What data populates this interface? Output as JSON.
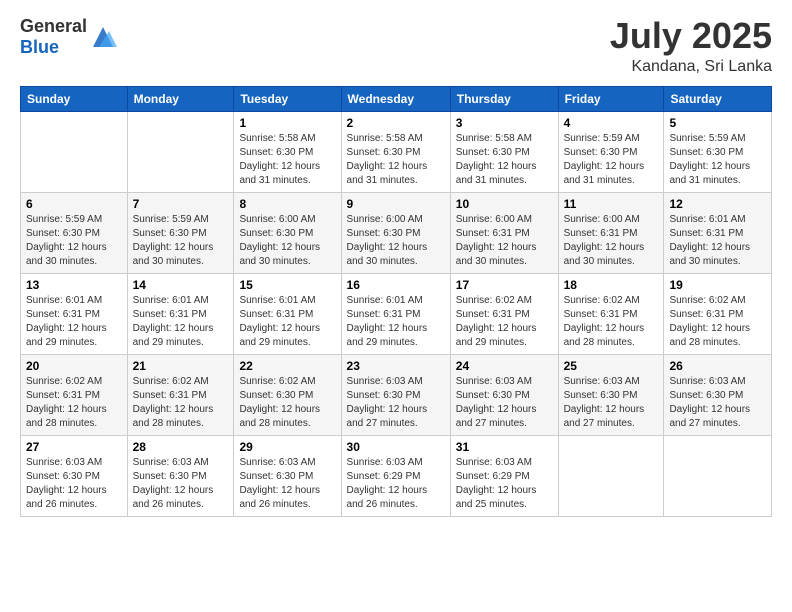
{
  "logo": {
    "text_general": "General",
    "text_blue": "Blue"
  },
  "header": {
    "month_year": "July 2025",
    "location": "Kandana, Sri Lanka"
  },
  "weekdays": [
    "Sunday",
    "Monday",
    "Tuesday",
    "Wednesday",
    "Thursday",
    "Friday",
    "Saturday"
  ],
  "weeks": [
    [
      {
        "day": "",
        "sunrise": "",
        "sunset": "",
        "daylight": ""
      },
      {
        "day": "",
        "sunrise": "",
        "sunset": "",
        "daylight": ""
      },
      {
        "day": "1",
        "sunrise": "Sunrise: 5:58 AM",
        "sunset": "Sunset: 6:30 PM",
        "daylight": "Daylight: 12 hours and 31 minutes."
      },
      {
        "day": "2",
        "sunrise": "Sunrise: 5:58 AM",
        "sunset": "Sunset: 6:30 PM",
        "daylight": "Daylight: 12 hours and 31 minutes."
      },
      {
        "day": "3",
        "sunrise": "Sunrise: 5:58 AM",
        "sunset": "Sunset: 6:30 PM",
        "daylight": "Daylight: 12 hours and 31 minutes."
      },
      {
        "day": "4",
        "sunrise": "Sunrise: 5:59 AM",
        "sunset": "Sunset: 6:30 PM",
        "daylight": "Daylight: 12 hours and 31 minutes."
      },
      {
        "day": "5",
        "sunrise": "Sunrise: 5:59 AM",
        "sunset": "Sunset: 6:30 PM",
        "daylight": "Daylight: 12 hours and 31 minutes."
      }
    ],
    [
      {
        "day": "6",
        "sunrise": "Sunrise: 5:59 AM",
        "sunset": "Sunset: 6:30 PM",
        "daylight": "Daylight: 12 hours and 30 minutes."
      },
      {
        "day": "7",
        "sunrise": "Sunrise: 5:59 AM",
        "sunset": "Sunset: 6:30 PM",
        "daylight": "Daylight: 12 hours and 30 minutes."
      },
      {
        "day": "8",
        "sunrise": "Sunrise: 6:00 AM",
        "sunset": "Sunset: 6:30 PM",
        "daylight": "Daylight: 12 hours and 30 minutes."
      },
      {
        "day": "9",
        "sunrise": "Sunrise: 6:00 AM",
        "sunset": "Sunset: 6:30 PM",
        "daylight": "Daylight: 12 hours and 30 minutes."
      },
      {
        "day": "10",
        "sunrise": "Sunrise: 6:00 AM",
        "sunset": "Sunset: 6:31 PM",
        "daylight": "Daylight: 12 hours and 30 minutes."
      },
      {
        "day": "11",
        "sunrise": "Sunrise: 6:00 AM",
        "sunset": "Sunset: 6:31 PM",
        "daylight": "Daylight: 12 hours and 30 minutes."
      },
      {
        "day": "12",
        "sunrise": "Sunrise: 6:01 AM",
        "sunset": "Sunset: 6:31 PM",
        "daylight": "Daylight: 12 hours and 30 minutes."
      }
    ],
    [
      {
        "day": "13",
        "sunrise": "Sunrise: 6:01 AM",
        "sunset": "Sunset: 6:31 PM",
        "daylight": "Daylight: 12 hours and 29 minutes."
      },
      {
        "day": "14",
        "sunrise": "Sunrise: 6:01 AM",
        "sunset": "Sunset: 6:31 PM",
        "daylight": "Daylight: 12 hours and 29 minutes."
      },
      {
        "day": "15",
        "sunrise": "Sunrise: 6:01 AM",
        "sunset": "Sunset: 6:31 PM",
        "daylight": "Daylight: 12 hours and 29 minutes."
      },
      {
        "day": "16",
        "sunrise": "Sunrise: 6:01 AM",
        "sunset": "Sunset: 6:31 PM",
        "daylight": "Daylight: 12 hours and 29 minutes."
      },
      {
        "day": "17",
        "sunrise": "Sunrise: 6:02 AM",
        "sunset": "Sunset: 6:31 PM",
        "daylight": "Daylight: 12 hours and 29 minutes."
      },
      {
        "day": "18",
        "sunrise": "Sunrise: 6:02 AM",
        "sunset": "Sunset: 6:31 PM",
        "daylight": "Daylight: 12 hours and 28 minutes."
      },
      {
        "day": "19",
        "sunrise": "Sunrise: 6:02 AM",
        "sunset": "Sunset: 6:31 PM",
        "daylight": "Daylight: 12 hours and 28 minutes."
      }
    ],
    [
      {
        "day": "20",
        "sunrise": "Sunrise: 6:02 AM",
        "sunset": "Sunset: 6:31 PM",
        "daylight": "Daylight: 12 hours and 28 minutes."
      },
      {
        "day": "21",
        "sunrise": "Sunrise: 6:02 AM",
        "sunset": "Sunset: 6:31 PM",
        "daylight": "Daylight: 12 hours and 28 minutes."
      },
      {
        "day": "22",
        "sunrise": "Sunrise: 6:02 AM",
        "sunset": "Sunset: 6:30 PM",
        "daylight": "Daylight: 12 hours and 28 minutes."
      },
      {
        "day": "23",
        "sunrise": "Sunrise: 6:03 AM",
        "sunset": "Sunset: 6:30 PM",
        "daylight": "Daylight: 12 hours and 27 minutes."
      },
      {
        "day": "24",
        "sunrise": "Sunrise: 6:03 AM",
        "sunset": "Sunset: 6:30 PM",
        "daylight": "Daylight: 12 hours and 27 minutes."
      },
      {
        "day": "25",
        "sunrise": "Sunrise: 6:03 AM",
        "sunset": "Sunset: 6:30 PM",
        "daylight": "Daylight: 12 hours and 27 minutes."
      },
      {
        "day": "26",
        "sunrise": "Sunrise: 6:03 AM",
        "sunset": "Sunset: 6:30 PM",
        "daylight": "Daylight: 12 hours and 27 minutes."
      }
    ],
    [
      {
        "day": "27",
        "sunrise": "Sunrise: 6:03 AM",
        "sunset": "Sunset: 6:30 PM",
        "daylight": "Daylight: 12 hours and 26 minutes."
      },
      {
        "day": "28",
        "sunrise": "Sunrise: 6:03 AM",
        "sunset": "Sunset: 6:30 PM",
        "daylight": "Daylight: 12 hours and 26 minutes."
      },
      {
        "day": "29",
        "sunrise": "Sunrise: 6:03 AM",
        "sunset": "Sunset: 6:30 PM",
        "daylight": "Daylight: 12 hours and 26 minutes."
      },
      {
        "day": "30",
        "sunrise": "Sunrise: 6:03 AM",
        "sunset": "Sunset: 6:29 PM",
        "daylight": "Daylight: 12 hours and 26 minutes."
      },
      {
        "day": "31",
        "sunrise": "Sunrise: 6:03 AM",
        "sunset": "Sunset: 6:29 PM",
        "daylight": "Daylight: 12 hours and 25 minutes."
      },
      {
        "day": "",
        "sunrise": "",
        "sunset": "",
        "daylight": ""
      },
      {
        "day": "",
        "sunrise": "",
        "sunset": "",
        "daylight": ""
      }
    ]
  ]
}
